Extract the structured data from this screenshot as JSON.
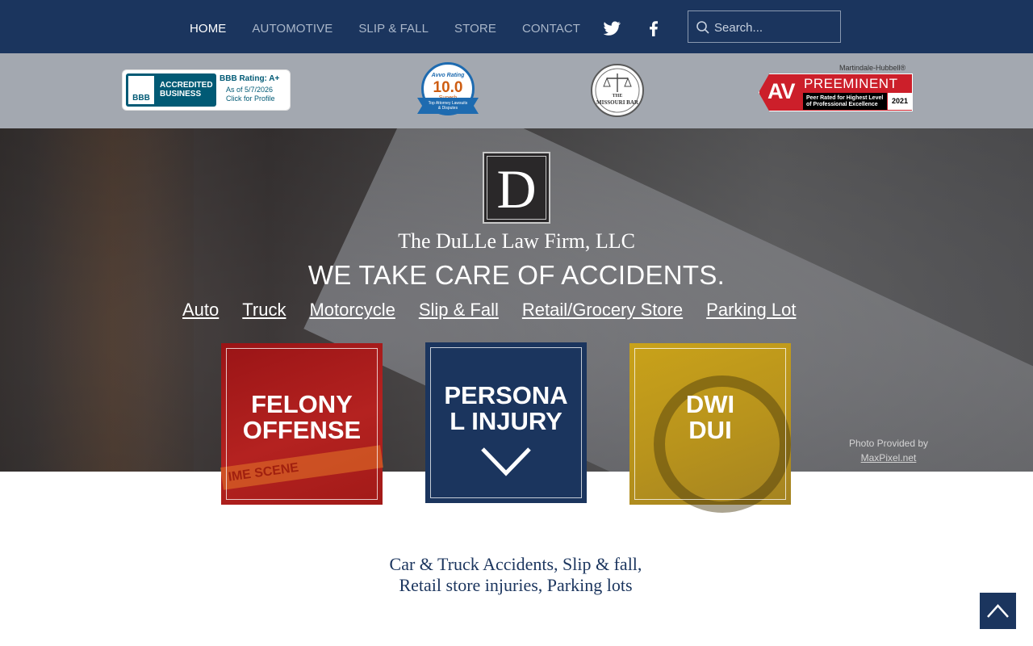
{
  "nav": {
    "items": [
      {
        "label": "HOME",
        "active": true
      },
      {
        "label": "AUTOMOTIVE",
        "active": false
      },
      {
        "label": "SLIP & FALL",
        "active": false
      },
      {
        "label": "STORE",
        "active": false
      },
      {
        "label": "CONTACT",
        "active": false
      }
    ],
    "social": [
      "twitter-icon",
      "facebook-icon"
    ],
    "search_placeholder": "Search..."
  },
  "badges": {
    "bbb": {
      "mark": "BBB",
      "accredited": "ACCREDITED BUSINESS",
      "rating": "BBB Rating: A+",
      "as_of": "As of 5/7/2026",
      "profile": "Click for Profile"
    },
    "avvo": {
      "brand": "Avvo Rating",
      "score": "10.0",
      "label": "Superb",
      "ribbon": "Top Attorney Lawsuits & Disputes"
    },
    "missouri_bar": {
      "line1": "THE",
      "line2": "MISSOURI BAR"
    },
    "martindale": {
      "brand": "Martindale-Hubbell®",
      "av": "AV",
      "title": "PREEMINENT",
      "peer": "Peer Rated for Highest Level of Professional Excellence",
      "year": "2021"
    }
  },
  "hero": {
    "logo_letter": "D",
    "firm_name": "The DuLLe Law Firm, LLC",
    "tagline": "WE TAKE CARE OF ACCIDENTS.",
    "links": [
      "Auto",
      "Truck",
      "Motorcycle",
      "Slip & Fall",
      "Retail/Grocery Store",
      "Parking Lot"
    ],
    "tiles": [
      {
        "label": "FELONY OFFENSE",
        "color": "#a81b1b",
        "tape_text": "IME SCENE"
      },
      {
        "label": "PERSONAL INJURY",
        "color": "#1b355e"
      },
      {
        "label": "DWI DUI",
        "color": "#c29c1d"
      }
    ],
    "credit": {
      "line1": "Photo Provided by",
      "link": "MaxPixel.net"
    }
  },
  "body": {
    "line1": "Car & Truck Accidents, Slip & fall,",
    "line2": "Retail store injuries, Parking lots"
  },
  "colors": {
    "navy": "#1b355e",
    "badge_bar": "#a3a8b0",
    "felony_red": "#a81b1b",
    "dwi_gold": "#c29c1d"
  }
}
